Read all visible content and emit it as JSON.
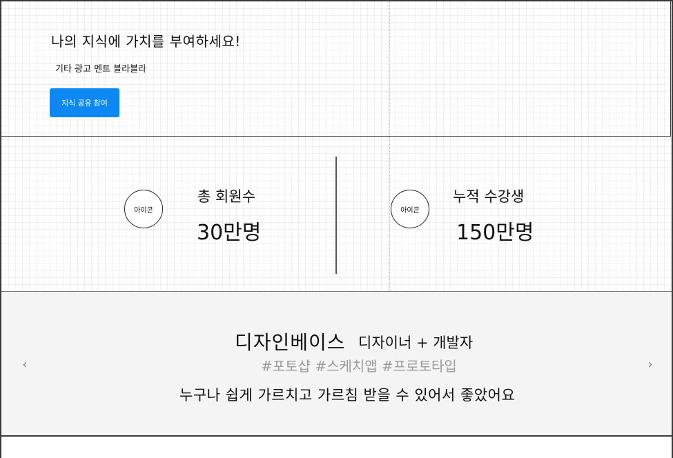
{
  "hero": {
    "title": "나의 지식에 가치를 부여하세요!",
    "subtitle": "기타 광고 멘트 블라블라",
    "cta_label": "지식 공유 참여",
    "cta_color": "#0d88f2"
  },
  "stats": [
    {
      "icon_label": "아이콘",
      "label": "총 회원수",
      "value": "30만명"
    },
    {
      "icon_label": "아이콘",
      "label": "누적 수강생",
      "value": "150만명"
    }
  ],
  "testimonial": {
    "name": "디자인베이스",
    "role": "디자이너 + 개발자",
    "tags": "#포토샵 #스케치앱 #프로토타입",
    "quote": "누구나 쉽게 가르치고 가르침 받을 수 있어서 좋았어요",
    "prev_arrow": "‹",
    "next_arrow": "›"
  }
}
